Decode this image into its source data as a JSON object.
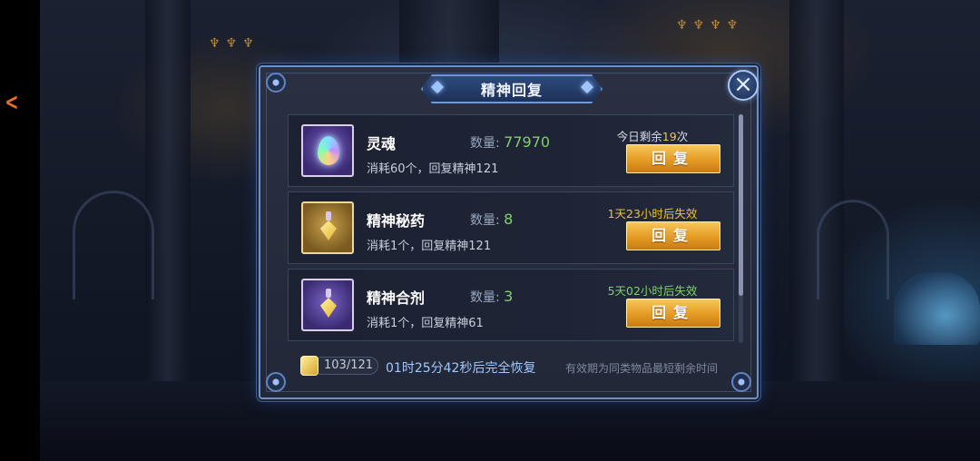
{
  "dialog": {
    "title": "精神回复",
    "close_icon": "×",
    "items": [
      {
        "name": "灵魂",
        "qty_label": "数量: ",
        "qty_value": "77970",
        "desc": "消耗60个，回复精神121",
        "status_prefix": "今日剩余",
        "status_count": "19",
        "status_suffix": "次",
        "button": "回复",
        "icon": "soul-gem-icon"
      },
      {
        "name": "精神秘药",
        "qty_label": "数量: ",
        "qty_value": "8",
        "desc": "消耗1个，回复精神121",
        "status": "1天23小时后失效",
        "button": "回复",
        "icon": "spirit-potion-icon"
      },
      {
        "name": "精神合剂",
        "qty_label": "数量: ",
        "qty_value": "3",
        "desc": "消耗1个，回复精神61",
        "status": "5天02小时后失效",
        "button": "回复",
        "icon": "spirit-mixture-icon"
      }
    ],
    "footer": {
      "stamina": "103/121",
      "timer": "01时25分42秒后完全恢复",
      "hint": "有效期为同类物品最短剩余时间"
    }
  },
  "colors": {
    "accent_gold": "#e49b24",
    "quantity_green": "#7fd06a",
    "expire_yellow": "#f0c030",
    "border_blue": "#6b8fc9"
  }
}
